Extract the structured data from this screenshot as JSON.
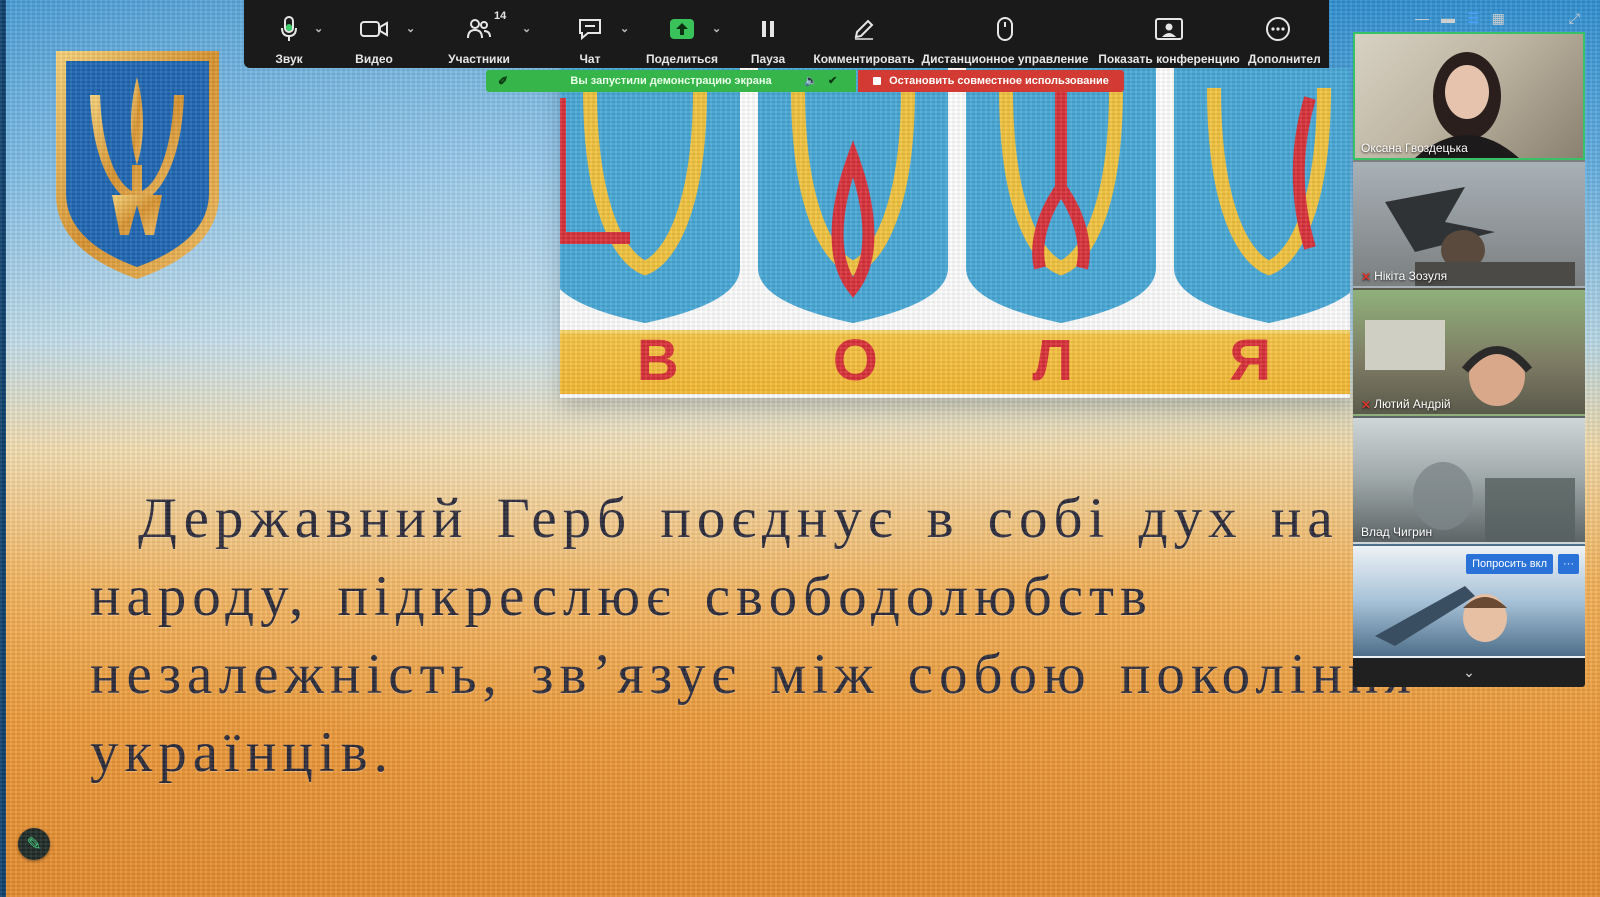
{
  "toolbar": {
    "audio_label": "Звук",
    "video_label": "Видео",
    "participants_label": "Участники",
    "participants_count": "14",
    "chat_label": "Чат",
    "share_label": "Поделиться",
    "pause_label": "Пауза",
    "annotate_label": "Комментировать",
    "remote_control_label": "Дистанционное управление",
    "show_meeting_label": "Показать конференцию",
    "more_label": "Дополнител"
  },
  "share_notice": {
    "status_text": "Вы запустили демонстрацию экрана",
    "stop_text": "Остановить совместное использование"
  },
  "slide": {
    "banner_letters": [
      "В",
      "О",
      "Л",
      "Я"
    ],
    "line1": "Державний Герб поєднує в собі дух на",
    "line2": "народу, підкреслює свободолюбств",
    "line3": "незалежність, зв’язує між собою покоління",
    "line4": "українців."
  },
  "participants": [
    {
      "name": "Оксана Гвоздецька",
      "muted": false
    },
    {
      "name": "Нікіта Зозуля",
      "muted": true
    },
    {
      "name": "Лютий Андрій",
      "muted": true
    },
    {
      "name": "Влад Чигрин",
      "muted": false
    },
    {
      "name": "",
      "muted": false
    }
  ],
  "panel": {
    "ask_button_label": "Попросить вкл",
    "more_button_label": "···"
  },
  "colors": {
    "toolbar_bg": "#1a1a1a",
    "share_green": "#35b54a",
    "stop_red": "#d23a33",
    "active_speaker": "#38c265",
    "ask_blue": "#2a72d8"
  }
}
